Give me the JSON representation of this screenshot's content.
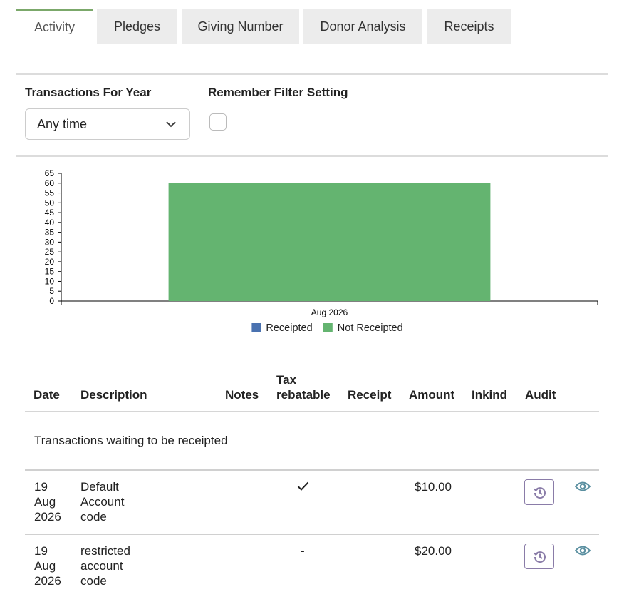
{
  "tabs": [
    {
      "label": "Activity",
      "active": true
    },
    {
      "label": "Pledges"
    },
    {
      "label": "Giving Number"
    },
    {
      "label": "Donor Analysis"
    },
    {
      "label": "Receipts"
    }
  ],
  "filters": {
    "year_label": "Transactions For Year",
    "year_value": "Any time",
    "remember_label": "Remember Filter Setting",
    "remember_checked": false
  },
  "chart_data": {
    "type": "bar",
    "categories": [
      "Aug 2026"
    ],
    "series": [
      {
        "name": "Receipted",
        "color": "#4a72b0",
        "values": [
          0
        ]
      },
      {
        "name": "Not Receipted",
        "color": "#64b470",
        "values": [
          60
        ]
      }
    ],
    "ylim": [
      0,
      65
    ],
    "yticks": [
      0,
      5,
      10,
      15,
      20,
      25,
      30,
      35,
      40,
      45,
      50,
      55,
      60,
      65
    ],
    "legend_position": "bottom-center",
    "grid": false
  },
  "table": {
    "headers": {
      "date": "Date",
      "description": "Description",
      "notes": "Notes",
      "tax_line1": "Tax",
      "tax_line2": "rebatable",
      "receipt": "Receipt",
      "amount": "Amount",
      "inkind": "Inkind",
      "audit": "Audit"
    },
    "group_label": "Transactions waiting to be receipted",
    "rows": [
      {
        "date": [
          "19",
          "Aug",
          "2026"
        ],
        "description": [
          "Default",
          "Account",
          "code"
        ],
        "tax": "✓",
        "amount": "$10.00"
      },
      {
        "date": [
          "19",
          "Aug",
          "2026"
        ],
        "description": [
          "restricted",
          "account",
          "code"
        ],
        "tax": "-",
        "amount": "$20.00"
      }
    ]
  },
  "icons": {
    "audit": "history-icon",
    "view": "eye-icon",
    "dropdown": "chevron-down-icon"
  },
  "colors": {
    "active_tab_accent": "#7ba86a",
    "tab_bg": "#ececec",
    "audit_icon": "#8a7ca8",
    "view_icon": "#5a8fa0"
  }
}
